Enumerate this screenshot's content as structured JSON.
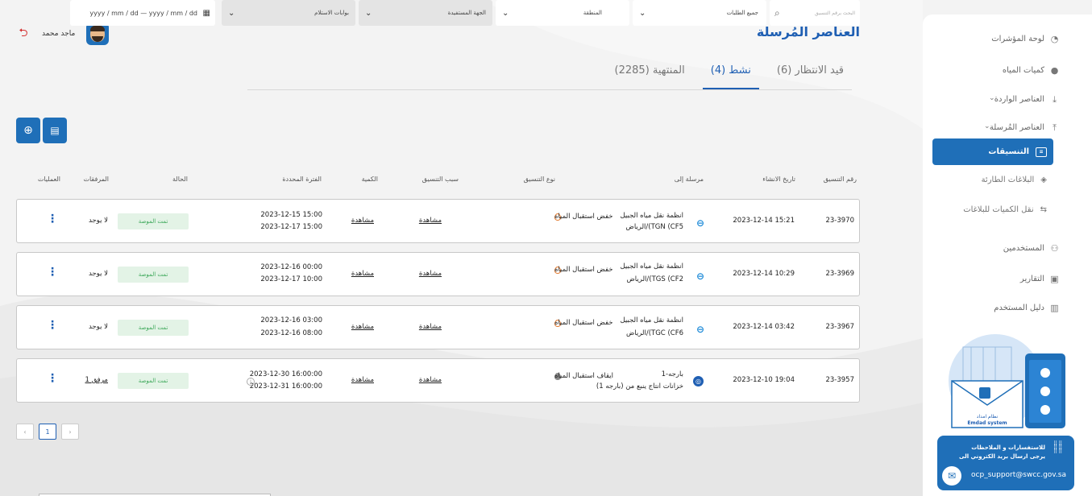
{
  "header": {
    "page_title": "العناصر المُرسلة",
    "user_name": "ماجد محمد"
  },
  "tabs": [
    {
      "label": "قيد الانتظار (6)"
    },
    {
      "label": "نشط (4)"
    },
    {
      "label": "المنتهية (2285)"
    }
  ],
  "filters": {
    "search_placeholder": "البحث برقم التنسيق",
    "requests_select": "جميع الطلبات",
    "region_select": "المنطقة",
    "beneficiary_select": "الجهة المستفيدة",
    "gates_select": "بوابات الاستلام",
    "date_range": "yyyy / mm / dd — yyyy / mm / dd"
  },
  "table": {
    "headers": {
      "number": "رقم التنسيق",
      "created": "تاريخ الانشاء",
      "sent_to": "مرسلة إلى",
      "type": "نوع التنسيق",
      "reason": "سبب التنسيق",
      "quantity": "الكمية",
      "period": "الفترة المحددة",
      "status": "الحالة",
      "attachments": "المرفقات",
      "actions": "العمليات"
    },
    "rows": [
      {
        "number": "23-3970",
        "created": "2023-12-14 15:21",
        "sent_to_1": "انظمة نقل مياه الجبيل",
        "sent_to_2": "الرياض/(TGN (CF5",
        "type": "خفض استقبال المياه",
        "reason": "مشاهدة",
        "quantity": "مشاهدة",
        "period_from": "2023-12-15 15:00",
        "period_to": "2023-12-17 15:00",
        "status": "تمت الموصة",
        "attachments": "لا يوجد"
      },
      {
        "number": "23-3969",
        "created": "2023-12-14 10:29",
        "sent_to_1": "انظمة نقل مياه الجبيل",
        "sent_to_2": "الرياض/(TGS (CF2",
        "type": "خفض استقبال المياه",
        "reason": "مشاهدة",
        "quantity": "مشاهدة",
        "period_from": "2023-12-16 00:00",
        "period_to": "2023-12-17 10:00",
        "status": "تمت الموصة",
        "attachments": "لا يوجد"
      },
      {
        "number": "23-3967",
        "created": "2023-12-14 03:42",
        "sent_to_1": "انظمة نقل مياه الجبيل",
        "sent_to_2": "الرياض/(TGC (CF6",
        "type": "خفض استقبال المياه",
        "reason": "مشاهدة",
        "quantity": "مشاهدة",
        "period_from": "2023-12-16 03:00",
        "period_to": "2023-12-16 08:00",
        "status": "تمت الموصة",
        "attachments": "لا يوجد"
      },
      {
        "number": "23-3957",
        "created": "2023-12-10 19:04",
        "sent_to_1": "بارجه-1",
        "sent_to_2": "خزانات انتاج ينبع من (بارجه 1)",
        "type": "ايقاف استقبال المياه",
        "reason": "مشاهدة",
        "quantity": "مشاهدة",
        "period_from": "2023-12-30 16:00:00",
        "period_to": "2023-12-31 16:00:00",
        "status": "تمت الموصة",
        "attachments": "1 مرفق"
      }
    ]
  },
  "pagination": {
    "current": "1"
  },
  "sidebar": {
    "items": [
      {
        "label": "لوحة المؤشرات"
      },
      {
        "label": "كميات المياه"
      },
      {
        "label": "العناصر الواردة"
      },
      {
        "label": "العناصر المُرسلة"
      },
      {
        "label": "التنسيقات"
      },
      {
        "label": "البلاغات الطارئة"
      },
      {
        "label": "نقل الكميات للبلاغات"
      },
      {
        "label": "المستخدمين"
      },
      {
        "label": "التقارير"
      },
      {
        "label": "دليل المستخدم"
      }
    ],
    "illustration_caption_1": "نظام امداد",
    "illustration_caption_2": "Emdad system",
    "contact_text": "للاستفسارات و الملاحظات يرجى ارسال بريد الكتروني الى",
    "contact_email": "ocp_support@swcc.gov.sa"
  },
  "colors": {
    "primary": "#1f6fb8",
    "title": "#1f5fb3",
    "status_bg": "#e3f3e6",
    "status_text": "#3da85a",
    "logout": "#d32f2f"
  }
}
